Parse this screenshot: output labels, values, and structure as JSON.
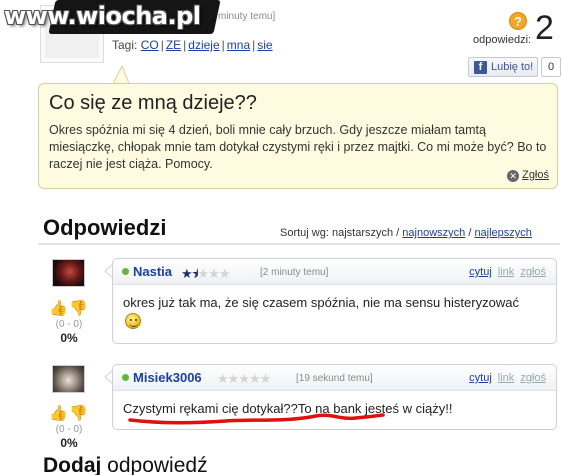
{
  "watermark": "www.wiocha.pl",
  "question": {
    "time": "minuty temu]",
    "tags_label": "Tagi:",
    "tags": [
      "CO",
      "ZE",
      "dzieje",
      "mna",
      "sie"
    ],
    "answers_label": "odpowiedzi:",
    "answers_count": "2",
    "like_label": "Lubię to!",
    "like_count": "0",
    "title": "Co się ze mną dzieje??",
    "body": "Okres spóźnia mi się 4 dzień, boli mnie cały brzuch. Gdy jeszcze miałam tamtą miesiączkę, chłopak mnie tam dotykał czystymi ręki i przez majtki. Co mi może być? Bo to raczej nie jest ciąża. Pomocy.",
    "report": "Zgłoś"
  },
  "answers_section": {
    "heading": "Odpowiedzi",
    "sort_label": "Sortuj wg: najstarszych",
    "sort_newest": "najnowszych",
    "sort_best": "najlepszych"
  },
  "answers": [
    {
      "author": "Nastia",
      "rating": 1.5,
      "time": "[2 minuty temu]",
      "text": "okres już tak ma, że się czasem spóźnia, nie ma sensu histeryzować",
      "votes": "(0 - 0)",
      "percent": "0%",
      "action_quote": "cytuj",
      "action_link": "link",
      "action_report": "zgłoś"
    },
    {
      "author": "Misiek3006",
      "rating": 0,
      "time": "[19 sekund temu]",
      "text": "Czystymi rękami cię dotykał??To na bank jesteś w ciąży!!",
      "votes": "(0 - 0)",
      "percent": "0%",
      "action_quote": "cytuj",
      "action_link": "link",
      "action_report": "zgłoś"
    }
  ],
  "add_answer": {
    "bold": "Dodaj",
    "rest": " odpowiedź"
  },
  "colors": {
    "link": "#1a3fa8",
    "question_bg": "#fffbe0",
    "underline_red": "#e01010"
  }
}
